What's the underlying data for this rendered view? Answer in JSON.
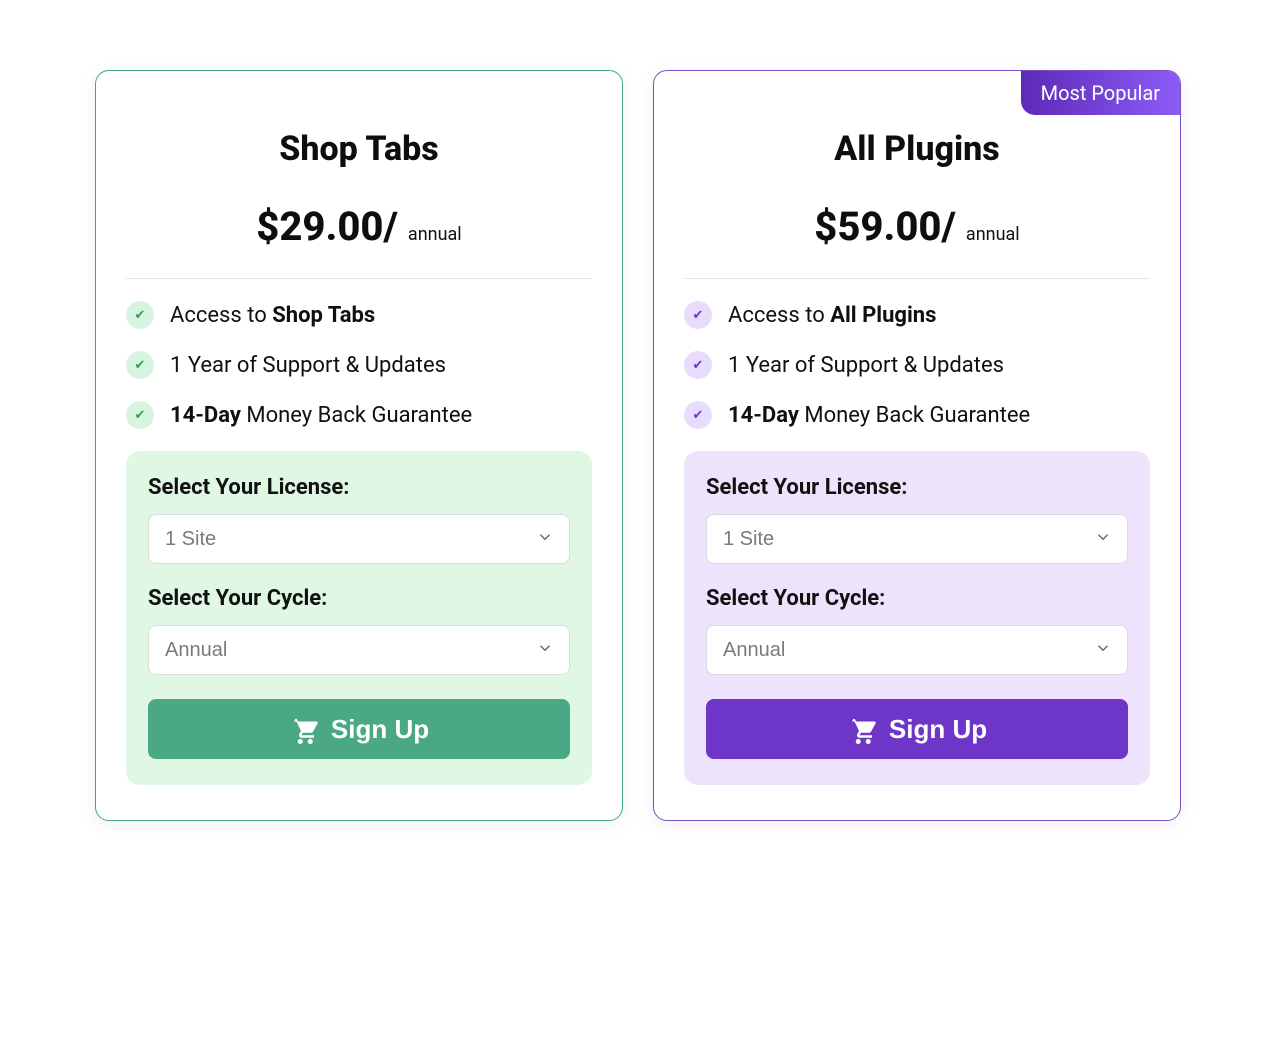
{
  "badge_label": "Most Popular",
  "labels": {
    "license": "Select Your License:",
    "cycle": "Select Your Cycle:",
    "button": "Sign Up"
  },
  "select_values": {
    "license": "1 Site",
    "cycle": "Annual"
  },
  "plans": [
    {
      "id": "shop-tabs",
      "color": "green",
      "title": "Shop Tabs",
      "price": "$29.00/",
      "period": "annual",
      "features": [
        {
          "prefix": "Access to ",
          "bold": "Shop Tabs",
          "suffix": ""
        },
        {
          "prefix": "1 Year of Support & Updates",
          "bold": "",
          "suffix": ""
        },
        {
          "prefix": "",
          "bold": "14-Day",
          "suffix": " Money Back Guarantee"
        }
      ]
    },
    {
      "id": "all-plugins",
      "color": "purple",
      "title": "All Plugins",
      "price": "$59.00/",
      "period": "annual",
      "badge": true,
      "features": [
        {
          "prefix": "Access to ",
          "bold": "All Plugins",
          "suffix": ""
        },
        {
          "prefix": "1 Year of Support & Updates",
          "bold": "",
          "suffix": ""
        },
        {
          "prefix": "",
          "bold": "14-Day",
          "suffix": " Money Back Guarantee"
        }
      ]
    }
  ]
}
